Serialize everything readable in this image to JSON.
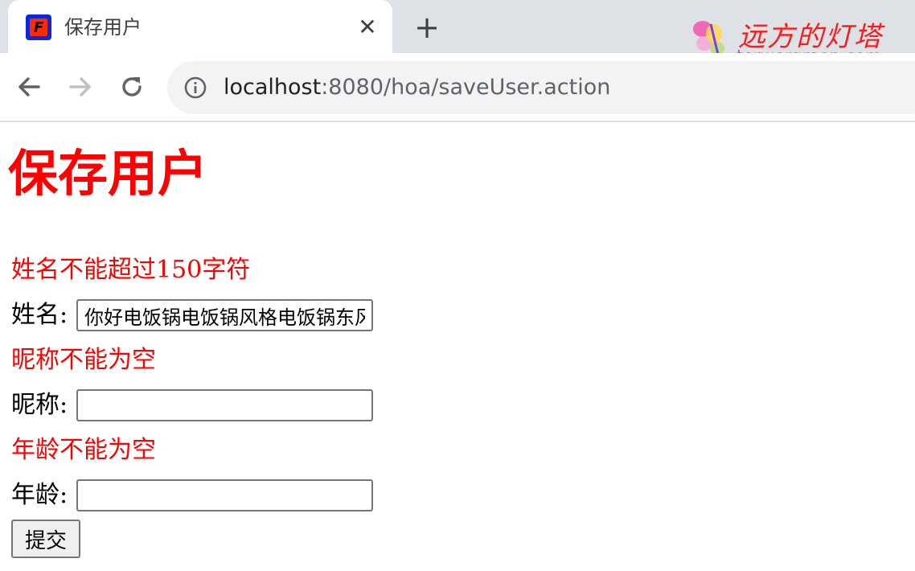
{
  "browser": {
    "tab": {
      "title": "保存用户",
      "close_label": "✕"
    },
    "new_tab_label": "+",
    "url": {
      "host": "localhost",
      "path": ":8080/hoa/saveUser.action"
    },
    "watermark": {
      "chinese": "远方的灯塔",
      "site": "terwergreen.com"
    }
  },
  "page": {
    "heading": "保存用户",
    "name_error": "姓名不能超过150字符",
    "name_label": "姓名:",
    "name_value": "你好电饭锅电饭锅风格电饭锅东风",
    "nickname_error": "昵称不能为空",
    "nickname_label": "昵称:",
    "nickname_value": "",
    "age_error": "年龄不能为空",
    "age_label": "年龄:",
    "age_value": "",
    "submit_label": "提交"
  },
  "colors": {
    "error": "#ff0000",
    "tab_bar": "#dee1e6",
    "omnibox": "#f1f3f4"
  }
}
